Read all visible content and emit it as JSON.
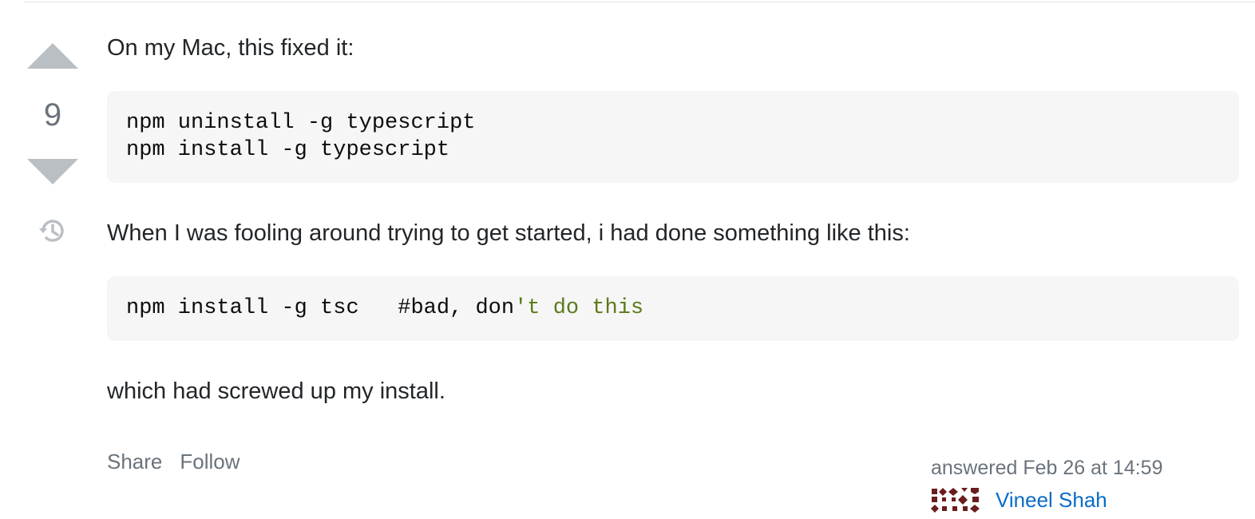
{
  "vote": {
    "count": "9",
    "up_icon": "arrow-up-icon",
    "down_icon": "arrow-down-icon",
    "history_icon": "history-icon"
  },
  "post": {
    "paragraphs": [
      "On my Mac, this fixed it:",
      "When I was fooling around trying to get started, i had done something like this:",
      "which had screwed up my install."
    ],
    "code_blocks": [
      {
        "lines": [
          "npm uninstall -g typescript",
          "npm install -g typescript"
        ]
      },
      {
        "line_plain": "npm install -g tsc   #bad, don",
        "line_string": "'t do this"
      }
    ]
  },
  "menu": {
    "share": "Share",
    "follow": "Follow"
  },
  "user_card": {
    "action": "answered Feb 26 at 14:59",
    "name": "Vineel Shah",
    "avatar_color": "#6b1d1d"
  },
  "colors": {
    "vote_arrow": "#babfc4",
    "link": "#0a6cc9",
    "code_bg": "#f6f6f6",
    "code_string": "#5b7a1b"
  }
}
